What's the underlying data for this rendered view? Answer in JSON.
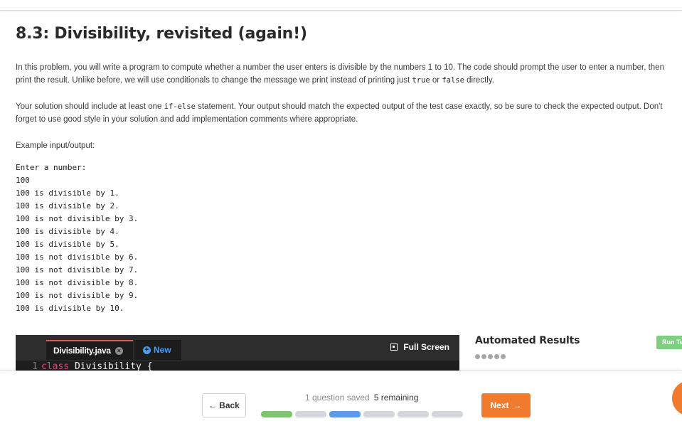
{
  "page": {
    "title": "8.3: Divisibility, revisited (again!)",
    "paragraph1": {
      "text_a": "In this problem, you will write a program to compute whether a number the user enters is divisible by the numbers 1 to 10. The code should prompt the user to enter a number, then print the result. Unlike before, we will use conditionals to change the message we print instead of printing just ",
      "code_true": "true",
      "text_b": " or ",
      "code_false": "false",
      "text_c": " directly."
    },
    "paragraph2": {
      "text_a": "Your solution should include at least one ",
      "code_ifelse": "if-else",
      "text_b": " statement. Your output should match the expected output of the test case exactly, so be sure to check the expected output. Don't forget to use good style in your solution and add implementation comments where appropriate."
    },
    "example_label": "Example input/output:",
    "example_io": [
      "Enter a number:",
      "100",
      "100 is divisible by 1.",
      "100 is divisible by 2.",
      "100 is not divisible by 3.",
      "100 is divisible by 4.",
      "100 is divisible by 5.",
      "100 is not divisible by 6.",
      "100 is not divisible by 7.",
      "100 is not divisible by 8.",
      "100 is not divisible by 9.",
      "100 is divisible by 10."
    ]
  },
  "editor": {
    "file_tab": "Divisibility.java",
    "new_tab": "New",
    "fullscreen_label": "Full Screen",
    "line_number": "1",
    "code_keyword": "class",
    "code_rest": " Divisibility {"
  },
  "results": {
    "title": "Automated Results",
    "run_button": "Run Te"
  },
  "footer": {
    "back_label": "Back",
    "saved_text": "1 question saved",
    "remaining_text": "5 remaining",
    "next_label": "Next",
    "progress": [
      "done",
      "todo",
      "current",
      "todo",
      "todo",
      "todo"
    ]
  },
  "colors": {
    "accent_orange": "#f07a2e",
    "progress_done": "#7cc66e",
    "progress_current": "#5b9ae8",
    "run_green": "#7ed07e",
    "editor_bg": "#2d2d2d",
    "new_tab_blue": "#4a9dff"
  }
}
